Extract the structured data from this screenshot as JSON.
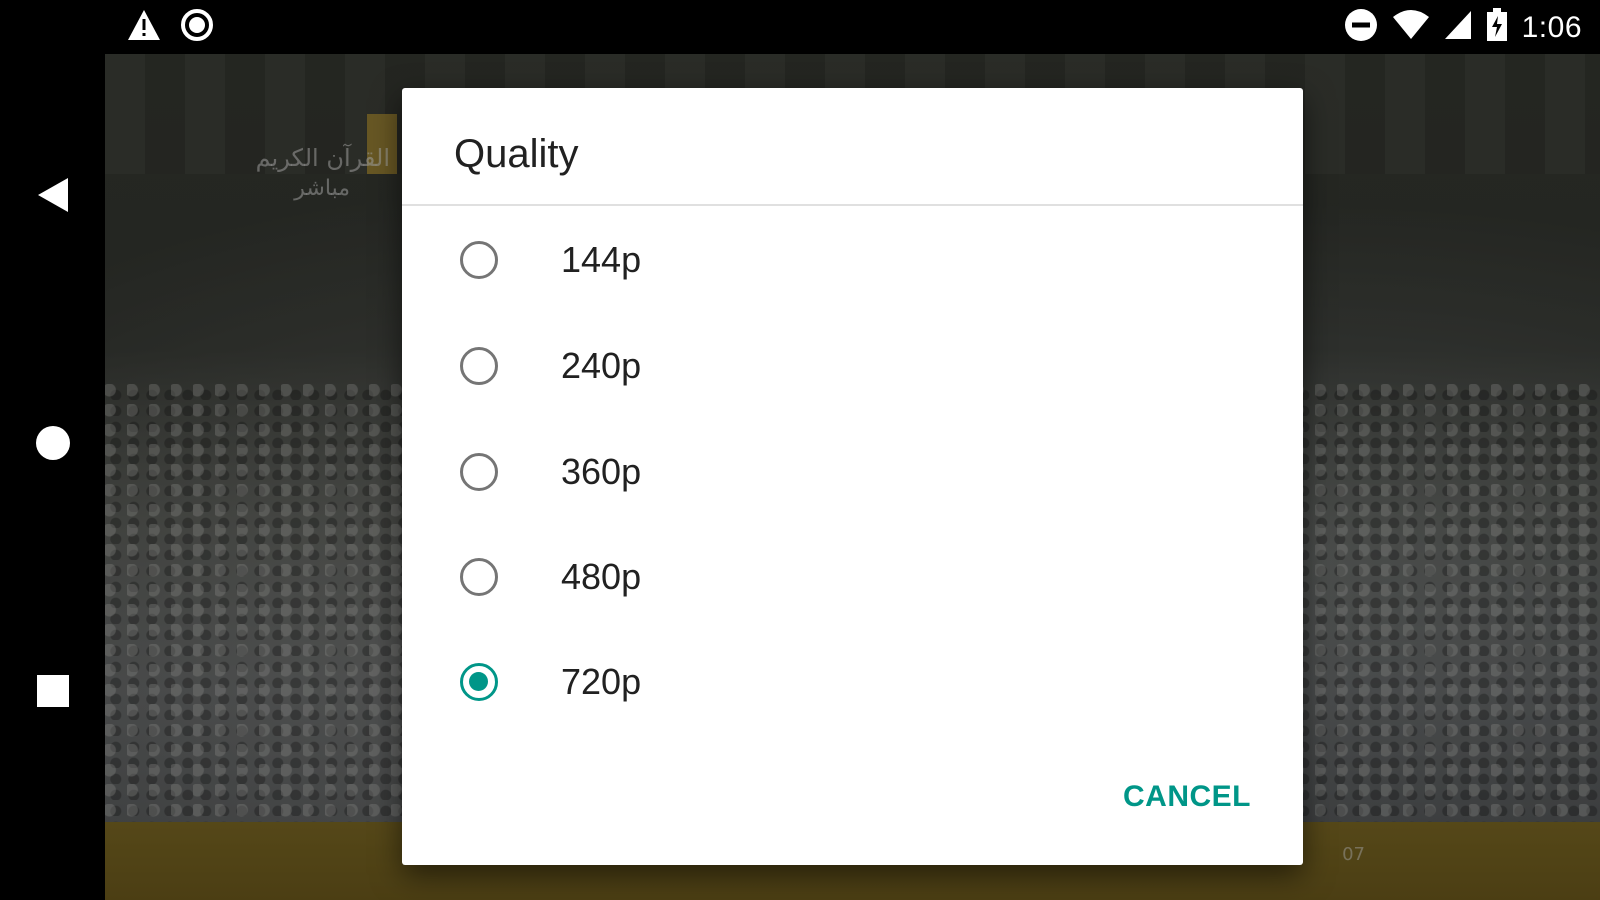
{
  "status_bar": {
    "time": "1:06",
    "icons": [
      "warning-icon",
      "record-icon",
      "do-not-disturb-icon",
      "wifi-icon",
      "signal-icon",
      "battery-charging-icon"
    ]
  },
  "nav_bar": {
    "icons": [
      "back-icon",
      "home-icon",
      "recents-icon"
    ]
  },
  "video": {
    "channel_logo_line1": "القرآن الكريم",
    "channel_logo_line2": "مباشر",
    "ticker_text": "07"
  },
  "dialog": {
    "title": "Quality",
    "options": [
      {
        "label": "144p",
        "selected": false
      },
      {
        "label": "240p",
        "selected": false
      },
      {
        "label": "360p",
        "selected": false
      },
      {
        "label": "480p",
        "selected": false
      },
      {
        "label": "720p",
        "selected": true
      }
    ],
    "cancel_label": "CANCEL",
    "accent_color": "#009688"
  }
}
